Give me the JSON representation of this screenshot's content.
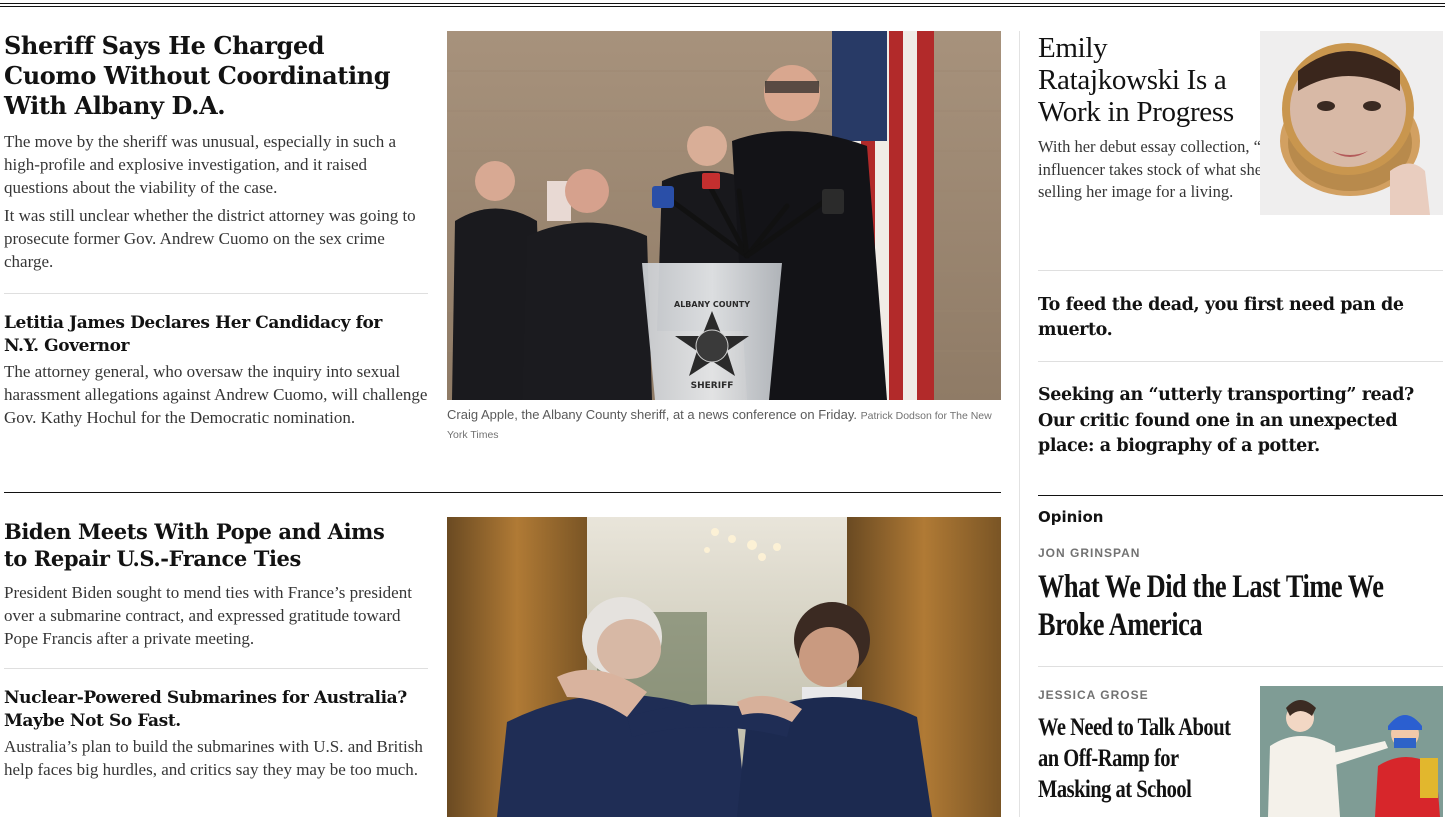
{
  "story1": {
    "headline": "Sheriff Says He Charged Cuomo Without Coordinating With Albany D.A.",
    "summary1": "The move by the sheriff was unusual, especially in such a high-profile and explosive investigation, and it raised questions about the viability of the case.",
    "summary2": "It was still unclear whether the district attorney was going to prosecute former Gov. Andrew Cuomo on the sex crime charge.",
    "photo_caption": "Craig Apple, the Albany County sheriff, at a news conference on Friday.",
    "photo_credit": "Patrick Dodson for The New York Times",
    "podium_text_top": "ALBANY COUNTY",
    "podium_text_bottom": "SHERIFF"
  },
  "story2": {
    "headline": "Letitia James Declares Her Candidacy for N.Y. Governor",
    "summary": "The attorney general, who oversaw the inquiry into sexual harassment allegations against Andrew Cuomo, will challenge Gov. Kathy Hochul for the Democratic nomination."
  },
  "story3": {
    "headline": "Biden Meets With Pope and Aims to Repair U.S.-France Ties",
    "summary": "President Biden sought to mend ties with France’s president over a submarine contract, and expressed gratitude toward Pope Francis after a private meeting."
  },
  "story4": {
    "headline": "Nuclear-Powered Submarines for Australia? Maybe Not So Fast.",
    "summary": "Australia’s plan to build the submarines with U.S. and British help faces big hurdles, and critics say they may be too much."
  },
  "right": {
    "feature_headline": "Emily Ratajkowski Is a Work in Progress",
    "feature_summary": "With her debut essay collection, “My Body,” the model and influencer takes stock of what she’s gained and lost from selling her image for a living.",
    "promo1": "To feed the dead, you first need pan de muerto.",
    "promo2": "Seeking an “utterly transporting” read? Our critic found one in an unexpected place: a biography of a potter."
  },
  "opinion": {
    "label": "Opinion",
    "item1": {
      "author": "JON GRINSPAN",
      "headline": "What We Did the Last Time We Broke America"
    },
    "item2": {
      "author": "JESSICA GROSE",
      "headline": "We Need to Talk About an Off-Ramp for Masking at School"
    }
  },
  "colors": {
    "text": "#121212",
    "summary": "#363636",
    "kicker": "#727272"
  }
}
